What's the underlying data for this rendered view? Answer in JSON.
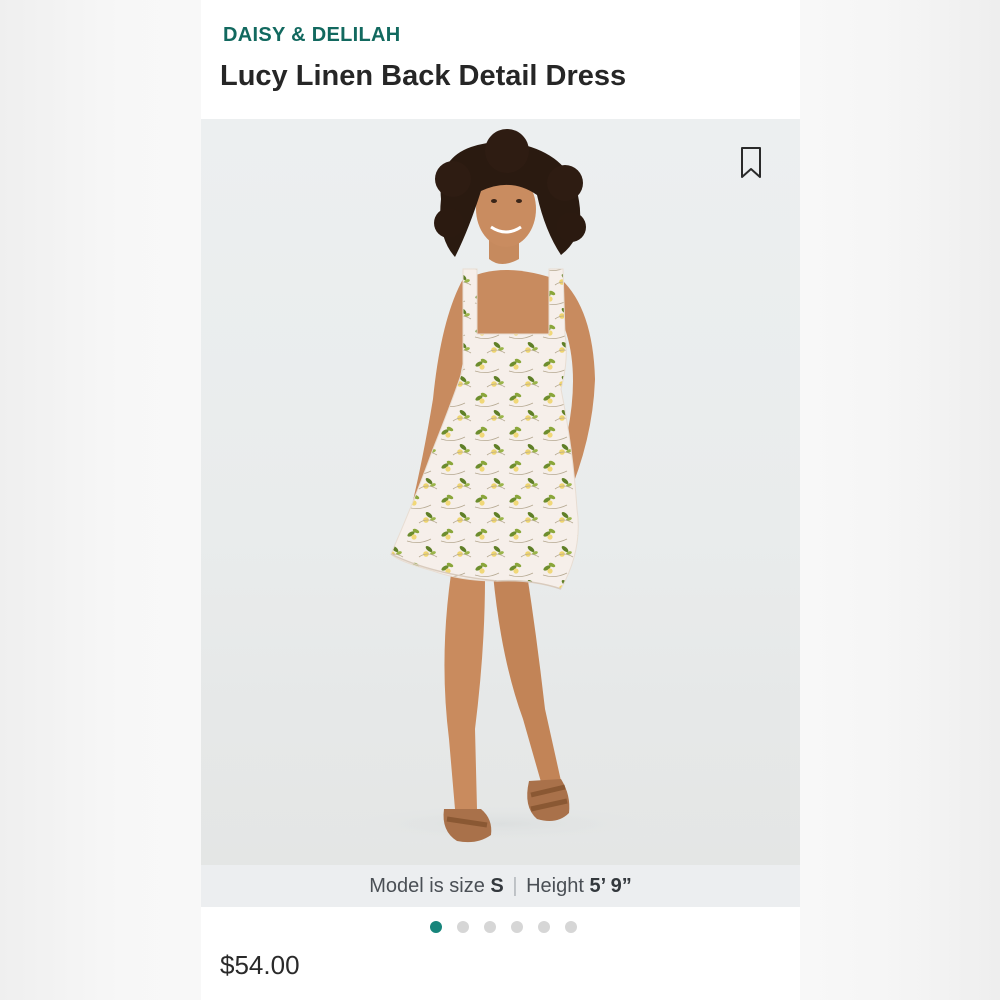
{
  "product": {
    "brand": "DAISY & DELILAH",
    "title": "Lucy Linen Back Detail Dress",
    "price": "$54.00"
  },
  "model_info": {
    "size_label": "Model is size",
    "size_value": "S",
    "separator": "|",
    "height_label": "Height",
    "height_value": "5’ 9”"
  },
  "carousel": {
    "total_images": 6,
    "active_index": 0
  },
  "icons": {
    "bookmark": "bookmark-icon"
  },
  "colors": {
    "brand": "#12695f",
    "active_dot": "#17857b",
    "inactive_dot": "#d6d6d6"
  }
}
